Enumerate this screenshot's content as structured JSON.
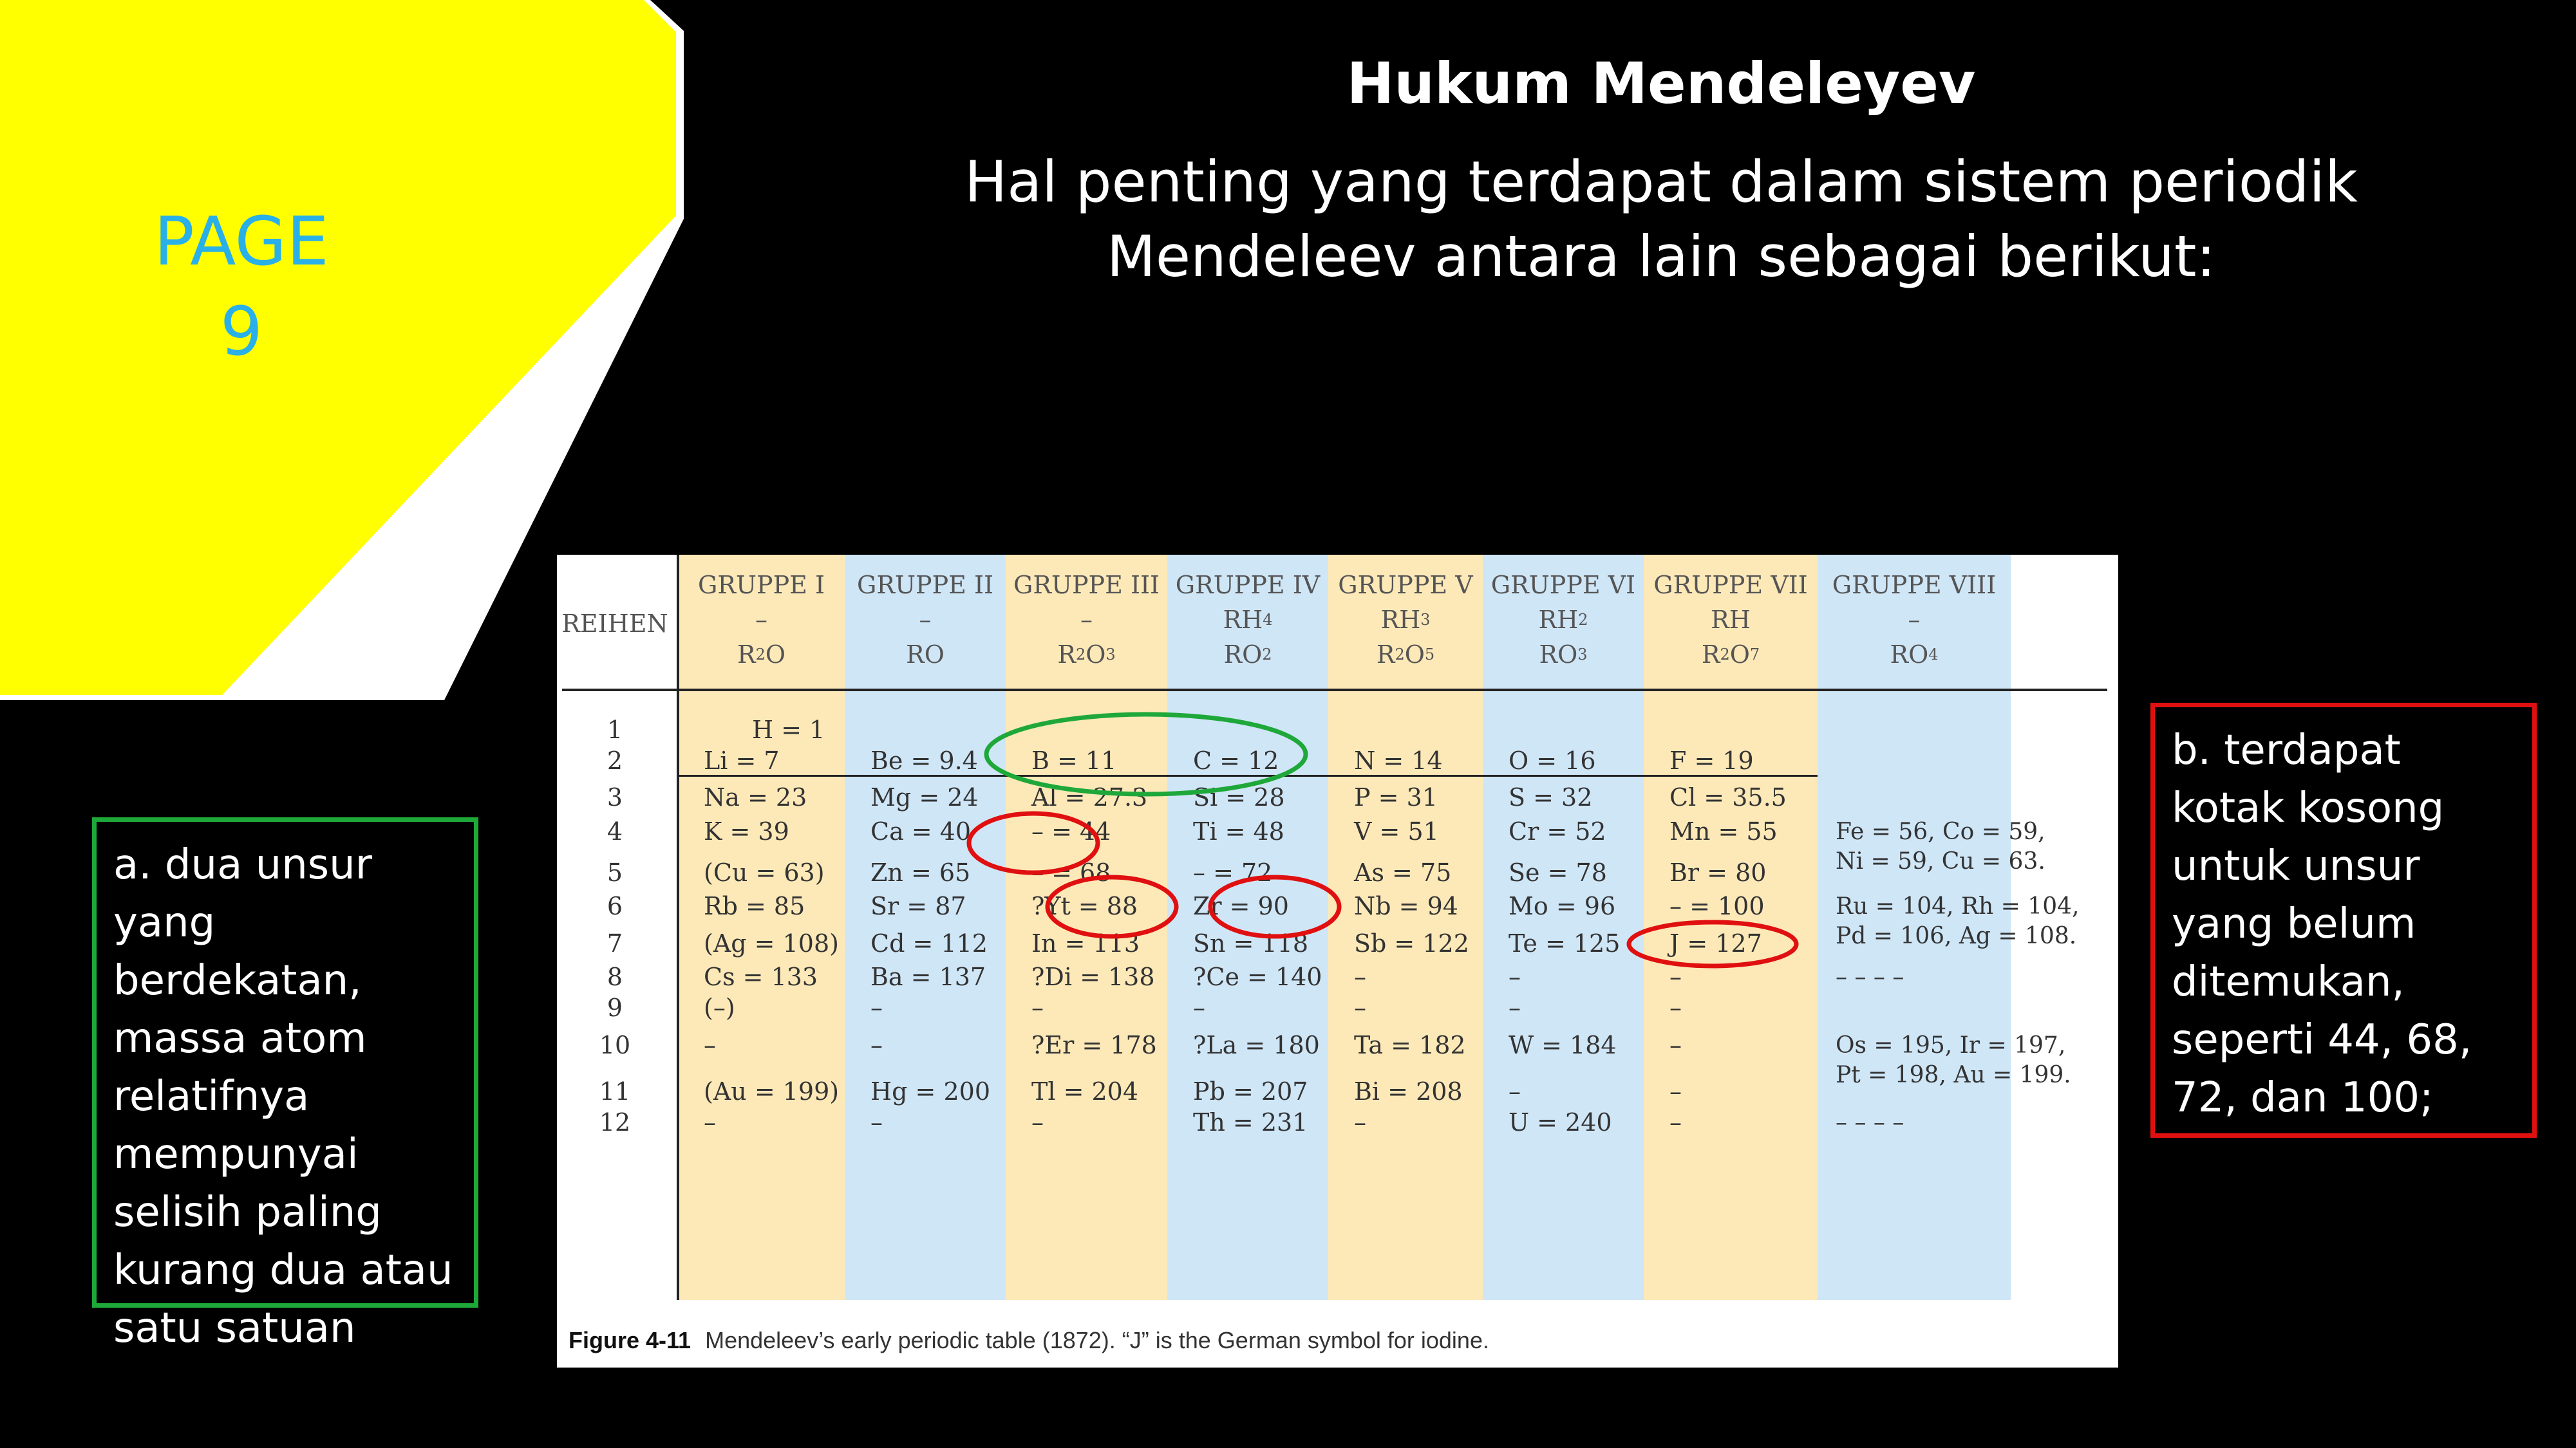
{
  "slide": {
    "page_label": "PAGE\n9",
    "title": "Hukum Mendeleyev",
    "subtitle": "Hal penting yang terdapat dalam sistem periodik Mendeleev antara lain sebagai berikut:",
    "note_a": "a. dua unsur yang berdekatan, massa atom relatifnya mempunyai selisih paling kurang dua atau satu satuan",
    "note_b": "b. terdapat kotak kosong untuk unsur yang belum ditemukan, seperti 44, 68, 72, dan 100;",
    "colors": {
      "background": "#000000",
      "octagon": "#ffff00",
      "page_label": "#2ab0e8",
      "green": "#1fa83a",
      "red": "#e01010",
      "tan": "#fde9b8",
      "blue": "#cfe6f7"
    }
  },
  "figure": {
    "reihen_header": "REIHEN",
    "columns": [
      {
        "name": "GRUPPE I",
        "hydride": "–",
        "oxide": "R²O"
      },
      {
        "name": "GRUPPE II",
        "hydride": "–",
        "oxide": "RO"
      },
      {
        "name": "GRUPPE III",
        "hydride": "–",
        "oxide": "R²O³"
      },
      {
        "name": "GRUPPE IV",
        "hydride": "RH⁴",
        "oxide": "RO²"
      },
      {
        "name": "GRUPPE V",
        "hydride": "RH³",
        "oxide": "R²O⁵"
      },
      {
        "name": "GRUPPE VI",
        "hydride": "RH²",
        "oxide": "RO³"
      },
      {
        "name": "GRUPPE VII",
        "hydride": "RH",
        "oxide": "R²O⁷"
      },
      {
        "name": "GRUPPE VIII",
        "hydride": "–",
        "oxide": "RO⁴"
      }
    ],
    "rows": [
      {
        "n": "1",
        "cells": [
          "H = 1",
          "",
          "",
          "",
          "",
          "",
          "",
          ""
        ]
      },
      {
        "n": "2",
        "cells": [
          "Li = 7",
          "Be = 9.4",
          "B = 11",
          "C = 12",
          "N = 14",
          "O = 16",
          "F = 19",
          ""
        ]
      },
      {
        "n": "3",
        "cells": [
          "Na = 23",
          "Mg = 24",
          "Al = 27.3",
          "Si = 28",
          "P = 31",
          "S = 32",
          "Cl = 35.5",
          ""
        ]
      },
      {
        "n": "4",
        "cells": [
          "K = 39",
          "Ca = 40",
          "– = 44",
          "Ti = 48",
          "V = 51",
          "Cr = 52",
          "Mn = 55",
          "Fe = 56, Co = 59,\nNi = 59, Cu = 63."
        ]
      },
      {
        "n": "5",
        "cells": [
          "(Cu = 63)",
          "Zn = 65",
          "– = 68",
          "– = 72",
          "As = 75",
          "Se = 78",
          "Br = 80",
          ""
        ]
      },
      {
        "n": "6",
        "cells": [
          "Rb = 85",
          "Sr = 87",
          "?Yt = 88",
          "Zr = 90",
          "Nb = 94",
          "Mo = 96",
          "– = 100",
          "Ru = 104, Rh = 104,\nPd = 106, Ag = 108."
        ]
      },
      {
        "n": "7",
        "cells": [
          "(Ag = 108)",
          "Cd = 112",
          "In = 113",
          "Sn = 118",
          "Sb = 122",
          "Te = 125",
          "J = 127",
          ""
        ]
      },
      {
        "n": "8",
        "cells": [
          "Cs = 133",
          "Ba = 137",
          "?Di = 138",
          "?Ce = 140",
          "–",
          "–",
          "–",
          "– – – –"
        ]
      },
      {
        "n": "9",
        "cells": [
          "(–)",
          "–",
          "–",
          "–",
          "–",
          "–",
          "–",
          ""
        ]
      },
      {
        "n": "10",
        "cells": [
          "–",
          "–",
          "?Er = 178",
          "?La = 180",
          "Ta = 182",
          "W = 184",
          "–",
          "Os = 195, Ir = 197,\nPt = 198, Au = 199."
        ]
      },
      {
        "n": "11",
        "cells": [
          "(Au = 199)",
          "Hg = 200",
          "Tl = 204",
          "Pb = 207",
          "Bi = 208",
          "–",
          "–",
          ""
        ]
      },
      {
        "n": "12",
        "cells": [
          "–",
          "–",
          "–",
          "Th = 231",
          "–",
          "U = 240",
          "–",
          "– – – –"
        ]
      }
    ],
    "caption_label": "Figure 4-11",
    "caption_text": "Mendeleev’s early periodic table (1872). “J” is the German symbol for iodine."
  }
}
